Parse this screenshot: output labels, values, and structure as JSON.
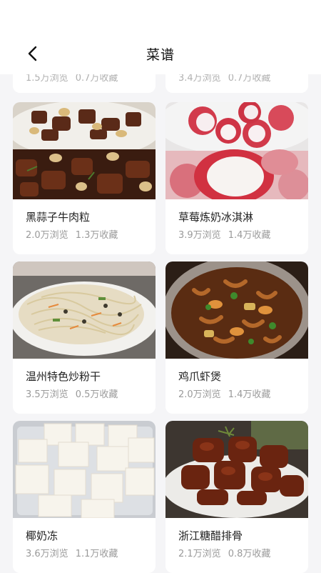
{
  "header": {
    "title": "菜谱",
    "back_icon": "chevron-left-icon"
  },
  "partial_row": [
    {
      "views": "1.5万浏览",
      "favorites": "0.7万收藏"
    },
    {
      "views": "3.4万浏览",
      "favorites": "0.7万收藏"
    }
  ],
  "recipes": [
    {
      "name": "黑蒜子牛肉粒",
      "views": "2.0万浏览",
      "favorites": "1.3万收藏"
    },
    {
      "name": "草莓炼奶冰淇淋",
      "views": "3.9万浏览",
      "favorites": "1.4万收藏"
    },
    {
      "name": "温州特色炒粉干",
      "views": "3.5万浏览",
      "favorites": "0.5万收藏"
    },
    {
      "name": "鸡爪虾煲",
      "views": "2.0万浏览",
      "favorites": "1.4万收藏"
    },
    {
      "name": "椰奶冻",
      "views": "3.6万浏览",
      "favorites": "1.1万收藏"
    },
    {
      "name": "浙江糖醋排骨",
      "views": "2.1万浏览",
      "favorites": "0.8万收藏"
    }
  ],
  "colors": {
    "background": "#f5f5f7",
    "card": "#ffffff",
    "meta_text": "#9a9a9a"
  }
}
